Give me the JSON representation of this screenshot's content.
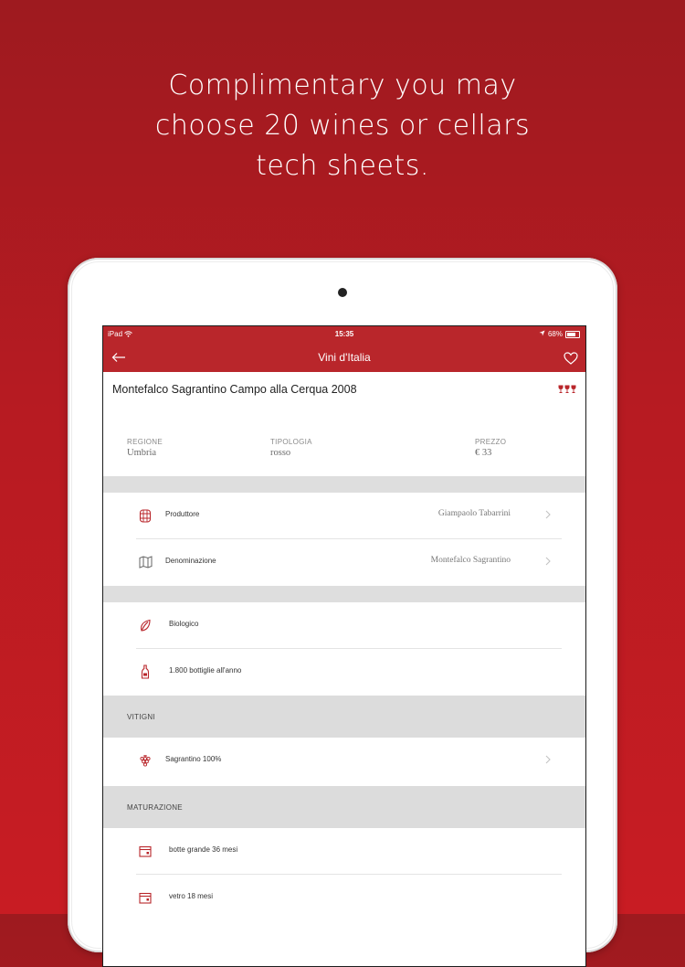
{
  "headline": {
    "line1": "Complimentary you may",
    "line2": "choose 20 wines or cellars",
    "line3": "tech sheets."
  },
  "status": {
    "carrier": "iPad",
    "time": "15:35",
    "battery": "68%"
  },
  "nav": {
    "title": "Vini d'Italia"
  },
  "wine": {
    "title": "Montefalco Sagrantino Campo alla Cerqua 2008",
    "rating_glasses": 3
  },
  "info": {
    "region_label": "REGIONE",
    "region_value": "Umbria",
    "type_label": "TIPOLOGIA",
    "type_value": "rosso",
    "price_label": "PREZZO",
    "price_value": "€ 33"
  },
  "details": {
    "producer_label": "Produttore",
    "producer_value": "Giampaolo Tabarrini",
    "denomination_label": "Denominazione",
    "denomination_value": "Montefalco Sagrantino",
    "organic_label": "Biologico",
    "bottles_label": "1.800 bottiglie all'anno"
  },
  "vitigni": {
    "header": "VITIGNI",
    "item": "Sagrantino 100%"
  },
  "maturazione": {
    "header": "MATURAZIONE",
    "item1": "botte grande 36 mesi",
    "item2": "vetro 18 mesi"
  },
  "colors": {
    "brand_red": "#b9262b",
    "background_red": "#c81c23"
  }
}
